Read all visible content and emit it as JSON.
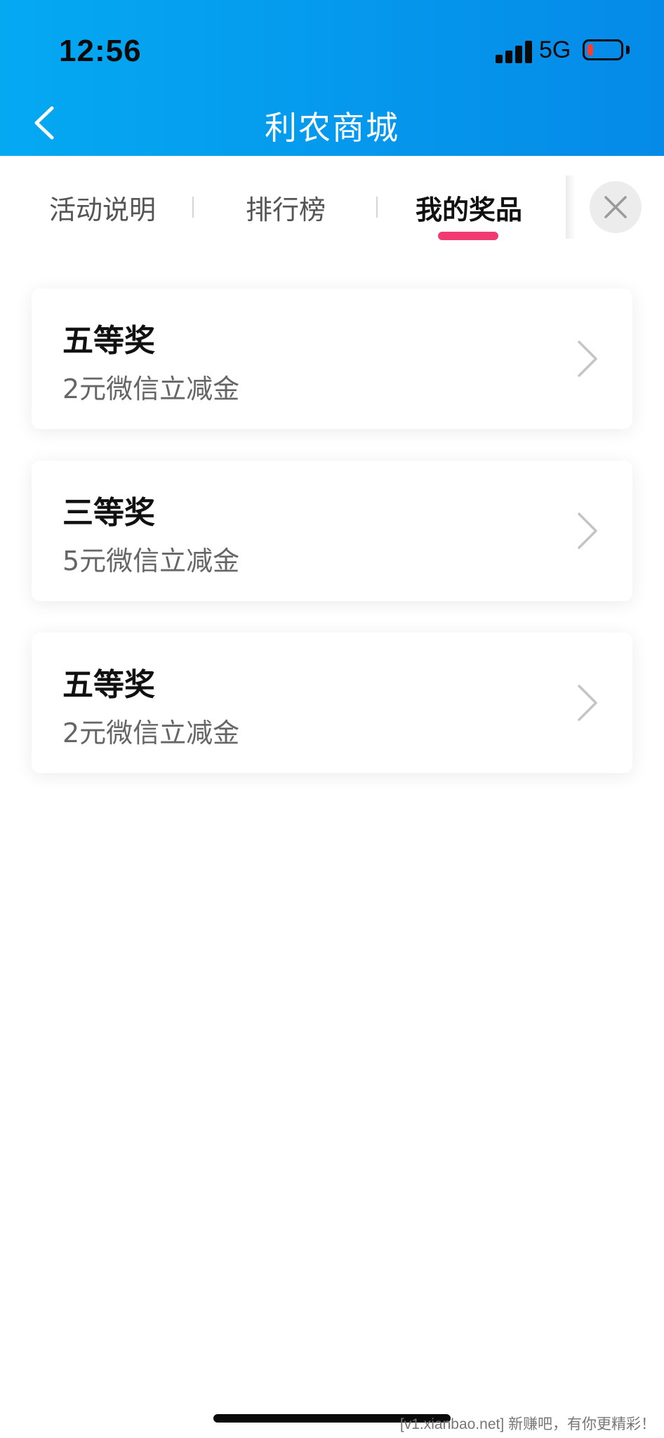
{
  "status_bar": {
    "time": "12:56",
    "network": "5G",
    "battery_color": "#ff3b30"
  },
  "nav": {
    "title": "利农商城",
    "back_icon": "chevron-left-icon"
  },
  "tabs": [
    {
      "label": "活动说明",
      "active": false
    },
    {
      "label": "排行榜",
      "active": false
    },
    {
      "label": "我的奖品",
      "active": true
    }
  ],
  "close_icon": "close-icon",
  "prizes": [
    {
      "title": "五等奖",
      "subtitle": "2元微信立减金"
    },
    {
      "title": "三等奖",
      "subtitle": "5元微信立减金"
    },
    {
      "title": "五等奖",
      "subtitle": "2元微信立减金"
    }
  ],
  "colors": {
    "header_start": "#05a9f2",
    "header_end": "#058ae8",
    "active_tab_underline": "#f23a72"
  },
  "watermark": "[v1.xianbao.net] 新赚吧，有你更精彩！"
}
